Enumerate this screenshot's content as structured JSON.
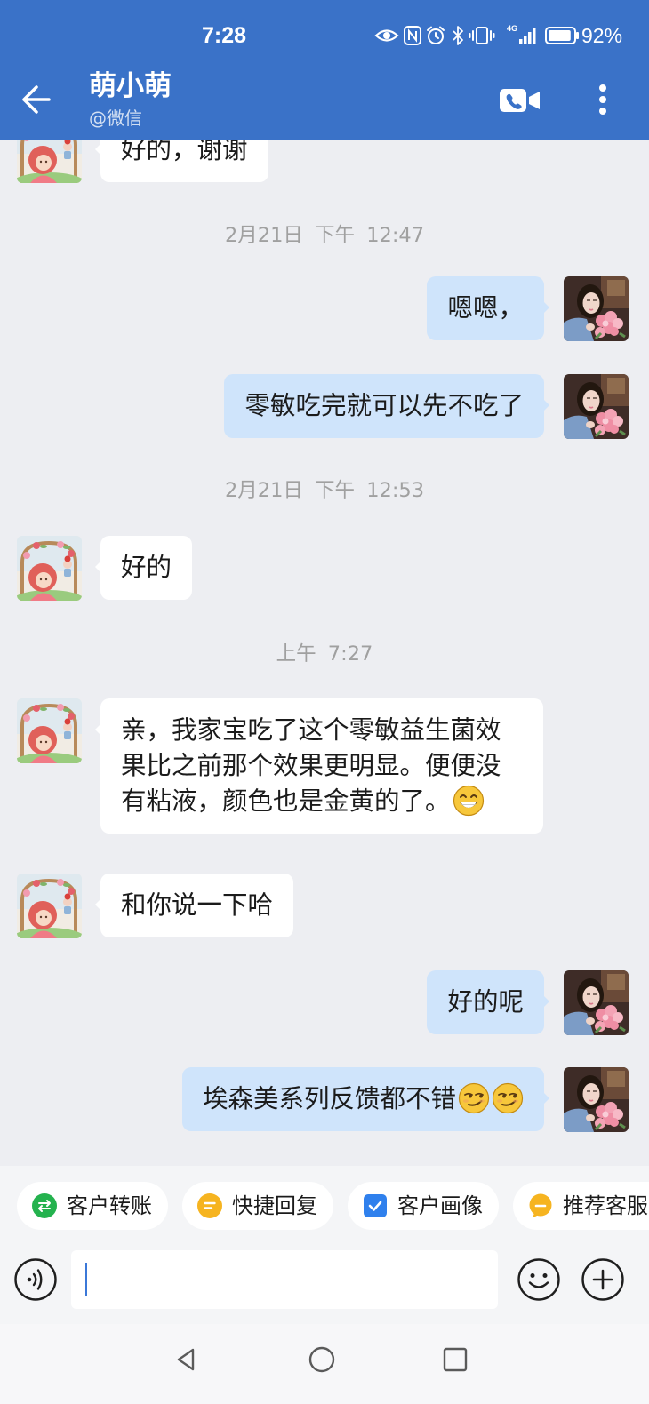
{
  "status_bar": {
    "time": "7:28",
    "network_type": "4G",
    "battery_percent_label": "92%",
    "battery_level": 0.92,
    "icons": [
      "eye-icon",
      "nfc-icon",
      "alarm-icon",
      "bluetooth-icon",
      "vibrate-icon",
      "signal-icon",
      "battery-icon"
    ]
  },
  "header": {
    "contact_name": "萌小萌",
    "contact_source": "@微信",
    "icons": [
      "back-arrow-icon",
      "video-call-icon",
      "more-vertical-icon"
    ]
  },
  "chat": {
    "items": [
      {
        "message": {
          "from_self": false,
          "text": "好的，谢谢"
        }
      },
      {
        "timestamp": "2月21日 下午 12:47"
      },
      {
        "message": {
          "from_self": true,
          "text": "嗯嗯，"
        }
      },
      {
        "message": {
          "from_self": true,
          "text": "零敏吃完就可以先不吃了"
        }
      },
      {
        "timestamp": "2月21日 下午 12:53"
      },
      {
        "message": {
          "from_self": false,
          "text": "好的"
        }
      },
      {
        "timestamp": "上午 7:27"
      },
      {
        "message": {
          "from_self": false,
          "text": "亲，我家宝吃了这个零敏益生菌效果比之前那个效果更明显。便便没有粘液，颜色也是金黄的了。",
          "emoji_icons": [
            "grinning-face-emoji-icon"
          ]
        }
      },
      {
        "message": {
          "from_self": false,
          "text": "和你说一下哈"
        }
      },
      {
        "message": {
          "from_self": true,
          "text": "好的呢"
        }
      },
      {
        "message": {
          "from_self": true,
          "text": "埃森美系列反馈都不错",
          "emoji_icons": [
            "smirking-face-emoji-icon",
            "smirking-face-emoji-icon"
          ]
        }
      }
    ]
  },
  "quick_actions": [
    {
      "label": "客户转账",
      "icon": "transfer-icon",
      "color": "#24b24e"
    },
    {
      "label": "快捷回复",
      "icon": "quick-reply-icon",
      "color": "#f6b420"
    },
    {
      "label": "客户画像",
      "icon": "customer-profile-icon",
      "color": "#2f80ed"
    },
    {
      "label": "推荐客服",
      "icon": "recommend-service-icon",
      "color": "#f6b420"
    }
  ],
  "composer": {
    "input_value": "",
    "icons": [
      "voice-input-icon",
      "emoji-icon",
      "plus-icon"
    ]
  },
  "nav_bar": {
    "icons": [
      "nav-back-icon",
      "nav-home-icon",
      "nav-recents-icon"
    ]
  },
  "colors": {
    "header_blue": "#3a72c8",
    "chat_background": "#edeef2",
    "incoming_bubble": "#ffffff",
    "outgoing_bubble": "#cfe4fb",
    "timestamp_text": "#a0a0a0",
    "cursor": "#3b78d8"
  }
}
